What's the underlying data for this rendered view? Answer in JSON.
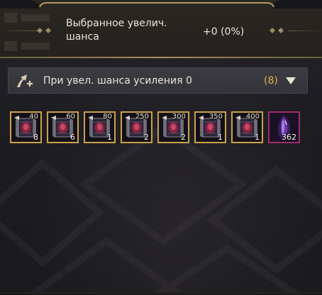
{
  "chance": {
    "label": "Выбранное увелич. шанса",
    "value": "+0 (0%)"
  },
  "dropdown": {
    "label": "При увел. шанса усиления 0",
    "count": "(8)",
    "icon": "enhance-arrow-icon",
    "arrow_icon": "triangle-down-icon"
  },
  "items": [
    {
      "level": "40",
      "quantity": "8",
      "icon": "scroll-icon"
    },
    {
      "level": "60",
      "quantity": "6",
      "icon": "scroll-icon"
    },
    {
      "level": "80",
      "quantity": "1",
      "icon": "scroll-icon"
    },
    {
      "level": "250",
      "quantity": "2",
      "icon": "scroll-icon"
    },
    {
      "level": "300",
      "quantity": "2",
      "icon": "scroll-icon"
    },
    {
      "level": "350",
      "quantity": "1",
      "icon": "scroll-icon"
    },
    {
      "level": "400",
      "quantity": "1",
      "icon": "scroll-icon"
    },
    {
      "level": "",
      "quantity": "362",
      "icon": "crystal-shard-icon"
    }
  ],
  "colors": {
    "gold_frame": "#c9a24a",
    "purple_frame": "#a12a6b",
    "count_accent": "#e4b04a",
    "text": "#ece6d8"
  }
}
